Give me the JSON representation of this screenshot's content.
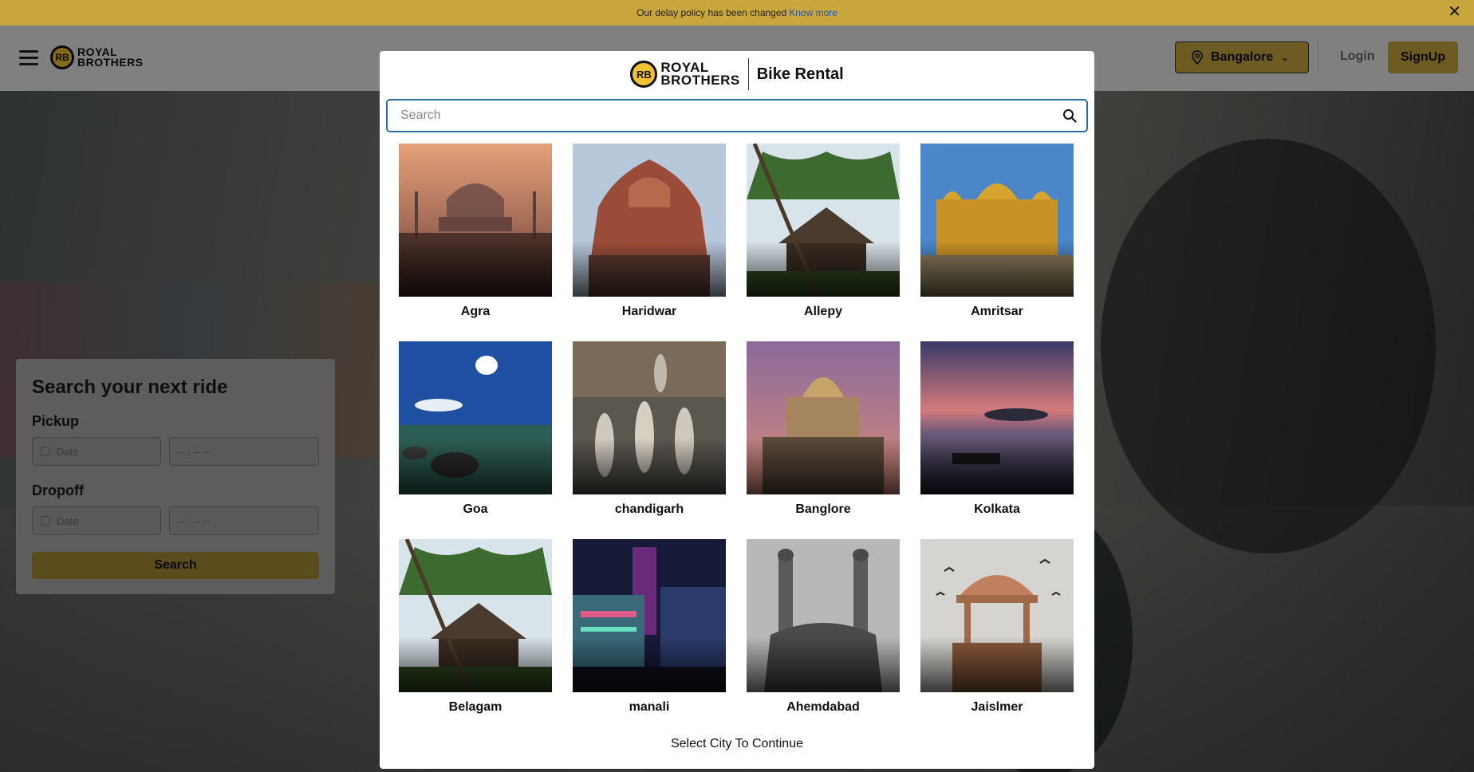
{
  "banner": {
    "text": "Our delay policy has been changed",
    "link": "Know more",
    "close": "✕"
  },
  "header": {
    "logo_badge": "RB",
    "logo_line1": "ROYAL",
    "logo_line2": "BROTHERS",
    "city": "Bangalore",
    "login": "Login",
    "signup": "SignUp"
  },
  "search_panel": {
    "title": "Search your next ride",
    "pickup_label": "Pickup",
    "dropoff_label": "Dropoff",
    "date_placeholder": "Date",
    "time_placeholder": "-- : --   --",
    "search_button": "Search"
  },
  "modal": {
    "logo_badge": "RB",
    "logo_line1": "ROYAL",
    "logo_line2": "BROTHERS",
    "title": "Bike Rental",
    "search_placeholder": "Search",
    "footer": "Select City To Continue",
    "cities": [
      {
        "name": "Agra"
      },
      {
        "name": "Haridwar"
      },
      {
        "name": "Allepy"
      },
      {
        "name": "Amritsar"
      },
      {
        "name": "Goa"
      },
      {
        "name": "chandigarh"
      },
      {
        "name": "Banglore"
      },
      {
        "name": "Kolkata"
      },
      {
        "name": "Belagam"
      },
      {
        "name": "manali"
      },
      {
        "name": "Ahemdabad"
      },
      {
        "name": "Jaislmer"
      }
    ]
  },
  "colors": {
    "brand_yellow": "#c9a73c",
    "search_border": "#2c6aa8"
  }
}
